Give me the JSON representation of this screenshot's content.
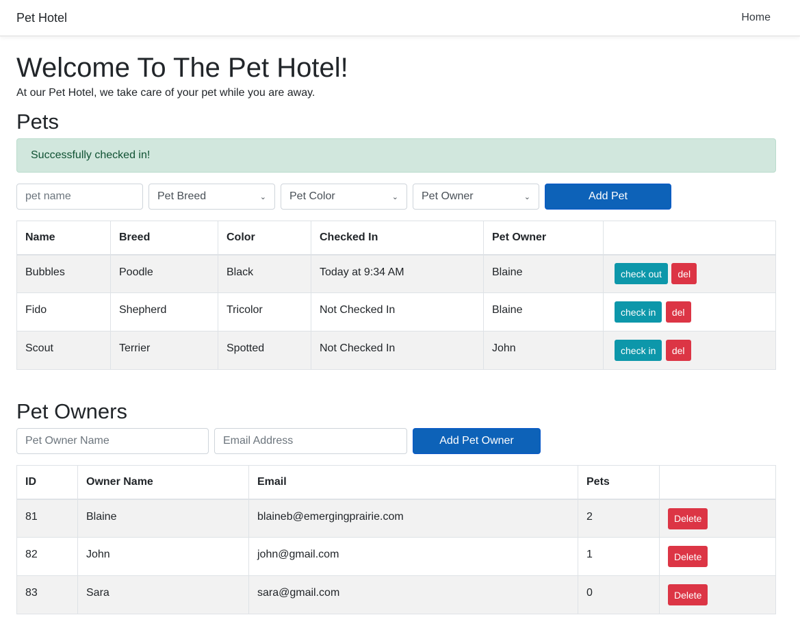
{
  "navbar": {
    "brand": "Pet Hotel",
    "home_link": "Home"
  },
  "header": {
    "title": "Welcome To The Pet Hotel!",
    "subtitle": "At our Pet Hotel, we take care of your pet while you are away."
  },
  "pets": {
    "heading": "Pets",
    "alert": "Successfully checked in!",
    "form": {
      "name_placeholder": "pet name",
      "breed_select": "Pet Breed",
      "color_select": "Pet Color",
      "owner_select": "Pet Owner",
      "add_button": "Add Pet"
    },
    "columns": [
      "Name",
      "Breed",
      "Color",
      "Checked In",
      "Pet Owner",
      ""
    ],
    "rows": [
      {
        "name": "Bubbles",
        "breed": "Poodle",
        "color": "Black",
        "checked_in": "Today at 9:34 AM",
        "owner": "Blaine",
        "action": "check out",
        "delete": "del"
      },
      {
        "name": "Fido",
        "breed": "Shepherd",
        "color": "Tricolor",
        "checked_in": "Not Checked In",
        "owner": "Blaine",
        "action": "check in",
        "delete": "del"
      },
      {
        "name": "Scout",
        "breed": "Terrier",
        "color": "Spotted",
        "checked_in": "Not Checked In",
        "owner": "John",
        "action": "check in",
        "delete": "del"
      }
    ]
  },
  "owners": {
    "heading": "Pet Owners",
    "form": {
      "name_placeholder": "Pet Owner Name",
      "email_placeholder": "Email Address",
      "add_button": "Add Pet Owner"
    },
    "columns": [
      "ID",
      "Owner Name",
      "Email",
      "Pets",
      ""
    ],
    "rows": [
      {
        "id": "81",
        "name": "Blaine",
        "email": "blaineb@emergingprairie.com",
        "pets": "2",
        "delete": "Delete"
      },
      {
        "id": "82",
        "name": "John",
        "email": "john@gmail.com",
        "pets": "1",
        "delete": "Delete"
      },
      {
        "id": "83",
        "name": "Sara",
        "email": "sara@gmail.com",
        "pets": "0",
        "delete": "Delete"
      }
    ]
  },
  "colors": {
    "primary": "#0d62b8",
    "info": "#0d97aa",
    "danger": "#dc3545",
    "alert_bg": "#d1e7dd",
    "alert_text": "#0f5132"
  }
}
